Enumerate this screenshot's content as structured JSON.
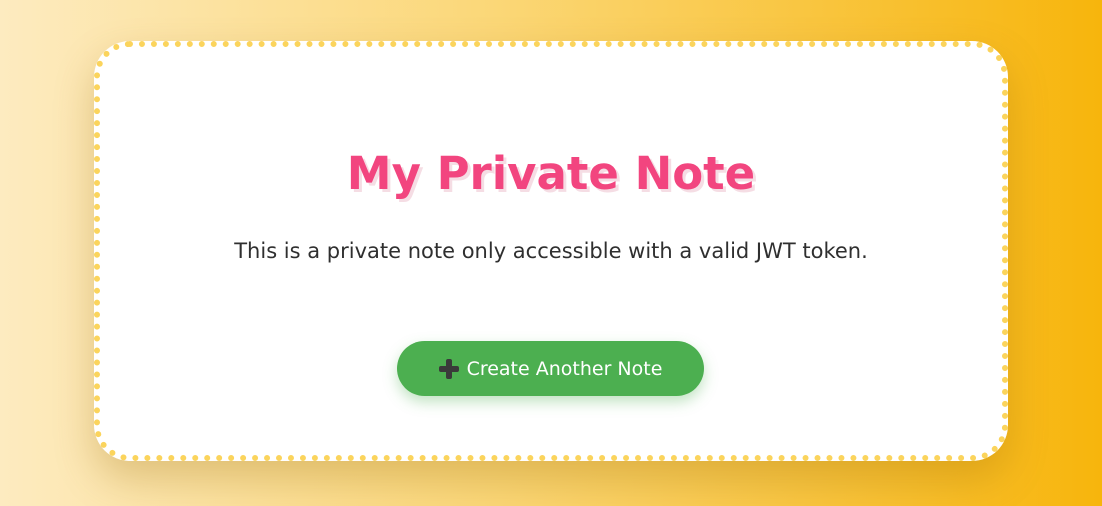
{
  "note": {
    "title": "My Private Note",
    "body": "This is a private note only accessible with a valid JWT token."
  },
  "actions": {
    "create_label": "Create Another Note",
    "create_icon": "plus-icon"
  },
  "colors": {
    "title": "#f2457f",
    "button": "#4caf50",
    "card_border": "#fbd45c",
    "background_start": "#fdebc0",
    "background_end": "#f7b50c"
  }
}
